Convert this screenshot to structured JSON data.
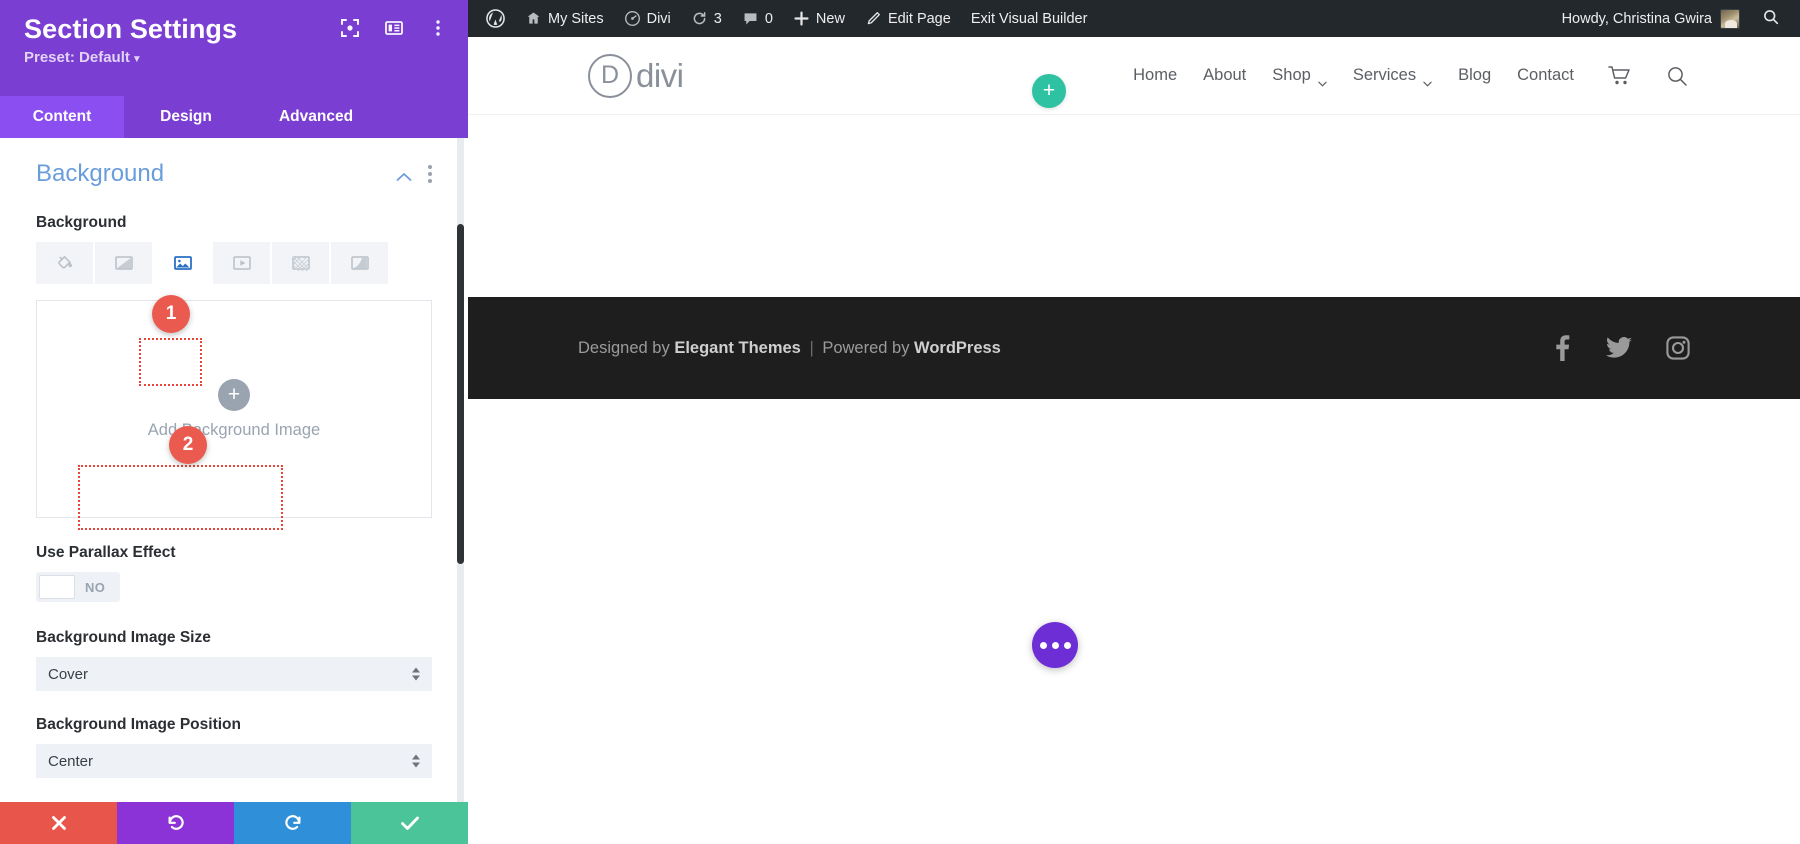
{
  "panel": {
    "title": "Section Settings",
    "preset_label": "Preset: Default",
    "tabs": [
      {
        "label": "Content",
        "active": true
      },
      {
        "label": "Design",
        "active": false
      },
      {
        "label": "Advanced",
        "active": false
      }
    ],
    "header_icons": [
      "focus-target-icon",
      "layout-panel-icon",
      "kebab-menu-icon"
    ],
    "section": {
      "title": "Background",
      "collapse_icon": "chevron-up-icon",
      "options_icon": "kebab-menu-icon"
    },
    "background_field_label": "Background",
    "background_types": [
      {
        "name": "background-color",
        "selected": false
      },
      {
        "name": "background-gradient",
        "selected": false
      },
      {
        "name": "background-image",
        "selected": true
      },
      {
        "name": "background-video",
        "selected": false
      },
      {
        "name": "background-pattern",
        "selected": false
      },
      {
        "name": "background-mask",
        "selected": false
      }
    ],
    "upload": {
      "text": "Add Background Image",
      "plus": "+"
    },
    "parallax": {
      "label": "Use Parallax Effect",
      "value": "NO"
    },
    "image_size": {
      "label": "Background Image Size",
      "value": "Cover"
    },
    "image_position": {
      "label": "Background Image Position",
      "value": "Center"
    },
    "actions": [
      {
        "name": "cancel",
        "icon": "close-icon",
        "color": "#e8554a"
      },
      {
        "name": "undo",
        "icon": "undo-icon",
        "color": "#8b33d6"
      },
      {
        "name": "redo",
        "icon": "redo-icon",
        "color": "#2f8fd8"
      },
      {
        "name": "save",
        "icon": "check-icon",
        "color": "#4bc49a"
      }
    ]
  },
  "annotations": [
    {
      "number": "1",
      "target": "background-image-type-icon"
    },
    {
      "number": "2",
      "target": "add-background-image-dropzone"
    }
  ],
  "adminbar": {
    "items": [
      {
        "label": "",
        "icon": "wordpress-logo-icon"
      },
      {
        "label": "My Sites",
        "icon": "multisite-icon"
      },
      {
        "label": "Divi",
        "icon": "divi-dashboard-icon"
      },
      {
        "label": "3",
        "icon": "updates-icon"
      },
      {
        "label": "0",
        "icon": "comments-icon"
      },
      {
        "label": "New",
        "icon": "plus-icon"
      },
      {
        "label": "Edit Page",
        "icon": "pencil-icon"
      },
      {
        "label": "Exit Visual Builder",
        "icon": ""
      }
    ],
    "howdy": "Howdy, Christina Gwira",
    "avatar": "user-avatar",
    "search_icon": "search-icon"
  },
  "site": {
    "logo_letter": "D",
    "logo_text": "divi",
    "nav": [
      {
        "label": "Home",
        "dropdown": false
      },
      {
        "label": "About",
        "dropdown": false
      },
      {
        "label": "Shop",
        "dropdown": true
      },
      {
        "label": "Services",
        "dropdown": true
      },
      {
        "label": "Blog",
        "dropdown": false
      },
      {
        "label": "Contact",
        "dropdown": false
      }
    ],
    "nav_icons": [
      "cart-icon",
      "search-icon"
    ]
  },
  "builder": {
    "add_module_label": "+",
    "fab_label": "page-settings-menu"
  },
  "footer": {
    "credit_prefix": "Designed by ",
    "credit_brand": "Elegant Themes",
    "credit_sep": " | ",
    "credit_mid": "Powered by ",
    "credit_brand2": "WordPress",
    "social": [
      "facebook-icon",
      "twitter-icon",
      "instagram-icon"
    ]
  },
  "colors": {
    "panel_purple": "#7a3ed2",
    "tab_active": "#8b4ef0",
    "accent_red": "#eb5a4e",
    "section_blue": "#6a9ddb",
    "teal": "#2ec2a2",
    "fab_purple": "#6d2ed6"
  }
}
